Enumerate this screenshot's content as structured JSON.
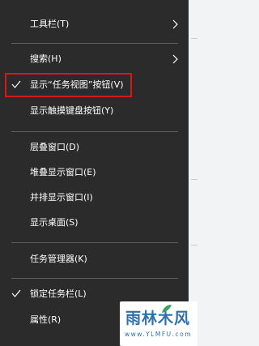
{
  "menu": {
    "items": [
      {
        "label": "工具栏(T)",
        "has_submenu": true,
        "checked": false
      },
      {
        "label": "搜索(H)",
        "has_submenu": true,
        "checked": false
      },
      {
        "label": "显示“任务视图”按钮(V)",
        "has_submenu": false,
        "checked": true,
        "highlighted": true
      },
      {
        "label": "显示触摸键盘按钮(Y)",
        "has_submenu": false,
        "checked": false
      },
      {
        "label": "层叠窗口(D)",
        "has_submenu": false,
        "checked": false
      },
      {
        "label": "堆叠显示窗口(E)",
        "has_submenu": false,
        "checked": false
      },
      {
        "label": "并排显示窗口(I)",
        "has_submenu": false,
        "checked": false
      },
      {
        "label": "显示桌面(S)",
        "has_submenu": false,
        "checked": false
      },
      {
        "label": "任务管理器(K)",
        "has_submenu": false,
        "checked": false
      },
      {
        "label": "锁定任务栏(L)",
        "has_submenu": false,
        "checked": true
      },
      {
        "label": "属性(R)",
        "has_submenu": false,
        "checked": false
      }
    ],
    "highlight_color": "#d11b1b",
    "background_color": "#2b2b2b"
  },
  "watermark": {
    "brand": "雨林木风",
    "url": "www.YLMFU.com",
    "color": "#2e6fae"
  }
}
